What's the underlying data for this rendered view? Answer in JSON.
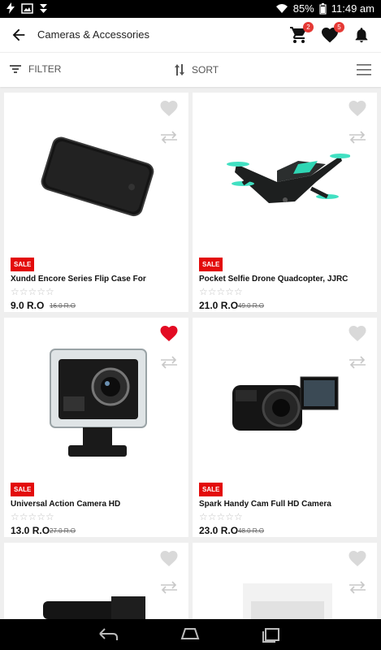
{
  "status": {
    "battery": "85%",
    "time": "11:49 am"
  },
  "app": {
    "title": "Cameras & Accessories",
    "cart_count": "2",
    "wishlist_count": "5"
  },
  "filter": {
    "filter_label": "FILTER",
    "sort_label": "SORT"
  },
  "products": [
    {
      "name": "Xundd Encore Series Flip Case For",
      "sale": "SALE",
      "price": "9.0 R.O",
      "old_price": "16.0 R.O",
      "wishlisted": false
    },
    {
      "name": "Pocket Selfie Drone Quadcopter, JJRC",
      "sale": "SALE",
      "price": "21.0 R.O",
      "old_price": "49.0 R.O",
      "wishlisted": false
    },
    {
      "name": "Universal  Action Camera HD",
      "sale": "SALE",
      "price": "13.0 R.O",
      "old_price": "27.0 R.O",
      "wishlisted": true
    },
    {
      "name": "Spark Handy Cam Full HD Camera",
      "sale": "SALE",
      "price": "23.0 R.O",
      "old_price": "48.0 R.O",
      "wishlisted": false
    }
  ],
  "stars_text": "☆☆☆☆☆",
  "colors": {
    "sale": "#e30b0b",
    "badge": "#e53935",
    "wishlist_active": "#e30b23"
  }
}
